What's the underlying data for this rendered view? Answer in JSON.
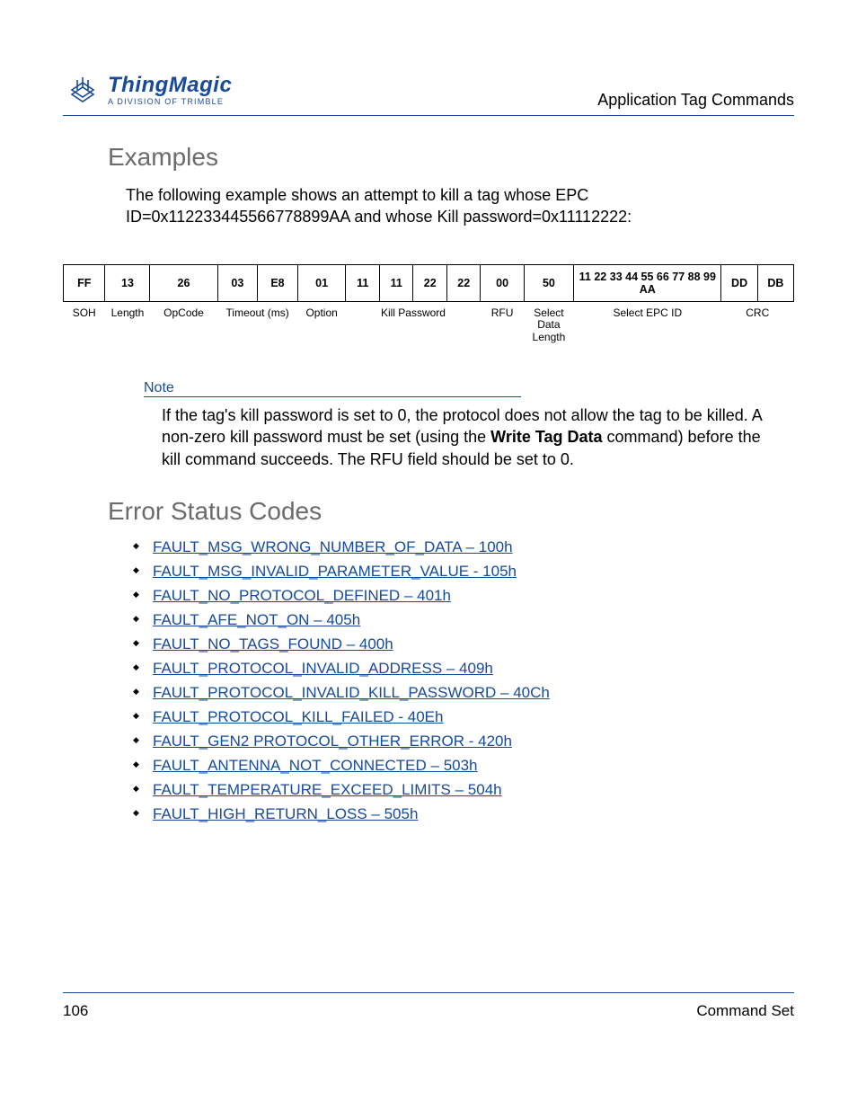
{
  "header": {
    "section_title": "Application Tag Commands",
    "logo_main": "ThingMagic",
    "logo_sub": "A DIVISION OF TRIMBLE"
  },
  "examples": {
    "heading": "Examples",
    "intro": "The following example shows an attempt to kill a tag whose EPC ID=0x112233445566778899AA and whose Kill password=0x11112222:",
    "bytes": [
      "FF",
      "13",
      "26",
      "03",
      "E8",
      "01",
      "11",
      "11",
      "22",
      "22",
      "00",
      "50",
      "11 22 33 44 55 66 77 88 99 AA",
      "DD",
      "DB"
    ],
    "labels": [
      "SOH",
      "Length",
      "OpCode",
      "Timeout (ms)",
      "",
      "Option",
      "Kill Password",
      "",
      "",
      "",
      "RFU",
      "Select Data Length",
      "Select EPC ID",
      "CRC",
      ""
    ]
  },
  "note": {
    "label": "Note",
    "body_pre": "If the tag's kill password is set to 0, the protocol does not allow the tag to be killed. A non-zero kill password must be set (using the ",
    "body_bold": "Write Tag Data",
    "body_post": " command) before the kill command succeeds. The RFU field should be set to 0."
  },
  "errors": {
    "heading": "Error Status Codes",
    "items": [
      "FAULT_MSG_WRONG_NUMBER_OF_DATA – 100h",
      "FAULT_MSG_INVALID_PARAMETER_VALUE - 105h",
      "FAULT_NO_PROTOCOL_DEFINED – 401h",
      "FAULT_AFE_NOT_ON – 405h",
      "FAULT_NO_TAGS_FOUND – 400h",
      "FAULT_PROTOCOL_INVALID_ADDRESS – 409h",
      "FAULT_PROTOCOL_INVALID_KILL_PASSWORD – 40Ch",
      "FAULT_PROTOCOL_KILL_FAILED - 40Eh",
      "FAULT_GEN2 PROTOCOL_OTHER_ERROR - 420h",
      "FAULT_ANTENNA_NOT_CONNECTED – 503h",
      "FAULT_TEMPERATURE_EXCEED_LIMITS – 504h",
      "FAULT_HIGH_RETURN_LOSS – 505h"
    ]
  },
  "footer": {
    "page": "106",
    "label": "Command Set"
  }
}
